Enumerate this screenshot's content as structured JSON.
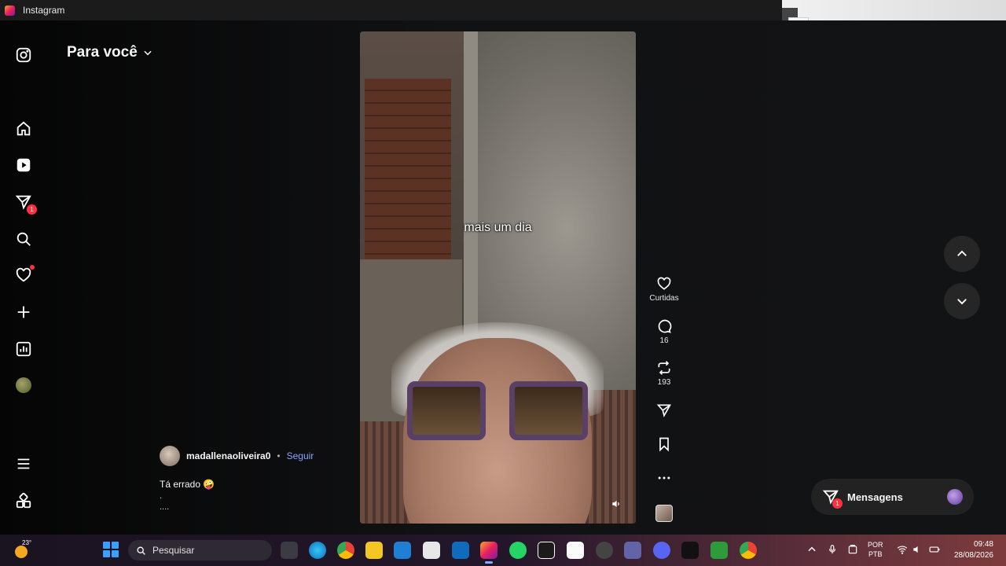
{
  "window": {
    "title": "Instagram"
  },
  "feed": {
    "title": "Para você"
  },
  "sidebar": {
    "messages_badge": "1"
  },
  "video": {
    "caption": "mais um dia"
  },
  "actions": {
    "likes_label": "Curtidas",
    "comments_count": "16",
    "reposts_count": "193"
  },
  "post": {
    "username": "madallenaoliveira0",
    "separator": "•",
    "follow_label": "Seguir",
    "caption": "Tá errado 🤪",
    "caption_line2": ".",
    "caption_more": "...."
  },
  "messages": {
    "label": "Mensagens",
    "badge": "1"
  },
  "taskbar": {
    "temperature": "23°",
    "search_placeholder": "Pesquisar",
    "language": "POR",
    "layout": "PTB",
    "time": "09:48",
    "date": "28/08/2026"
  }
}
